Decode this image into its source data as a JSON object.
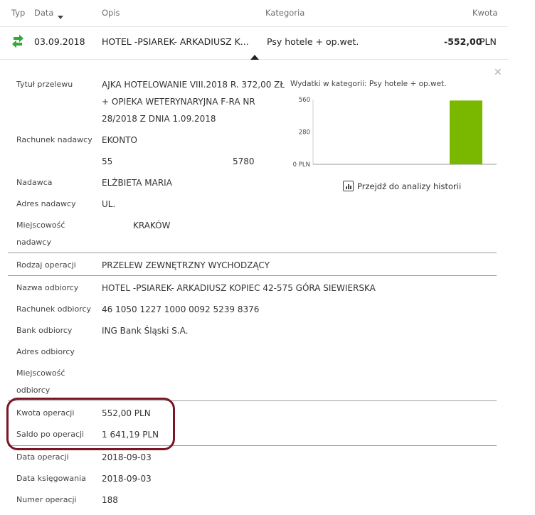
{
  "header": {
    "typ": "Typ",
    "data": "Data",
    "opis": "Opis",
    "kategoria": "Kategoria",
    "kwota": "Kwota"
  },
  "transaction": {
    "date": "03.09.2018",
    "description": "HOTEL -PSIAREK- ARKADIUSZ K...",
    "category": "Psy hotele + op.wet.",
    "amount": "-552,00",
    "currency": "PLN",
    "type_icon_color": "#35a83c"
  },
  "details": {
    "tytul": {
      "label": "Tytuł przelewu",
      "lines": [
        "AJKA HOTELOWANIE VIII.2018 R. 372,00 ZŁ",
        "+ OPIEKA WETERYNARYJNA F-RA NR",
        "28/2018 Z DNIA 1.09.2018"
      ]
    },
    "rachunek_nadawcy": {
      "label": "Rachunek nadawcy",
      "line1": "EKONTO",
      "part1": "55",
      "part2": "5780"
    },
    "nadawca": {
      "label": "Nadawca",
      "value": "ELŻBIETA MARIA"
    },
    "adres_nadawcy": {
      "label": "Adres nadawcy",
      "value": "UL."
    },
    "miejscowosc_nadawcy": {
      "label1": "Miejscowość",
      "label2": "nadawcy",
      "value": "KRAKÓW"
    },
    "rodzaj": {
      "label": "Rodzaj operacji",
      "value": "PRZELEW ZEWNĘTRZNY WYCHODZĄCY"
    },
    "nazwa_odbiorcy": {
      "label": "Nazwa odbiorcy",
      "value": "HOTEL -PSIAREK- ARKADIUSZ KOPIEC 42-575 GÓRA SIEWIERSKA"
    },
    "rachunek_odbiorcy": {
      "label": "Rachunek odbiorcy",
      "value": "46 1050 1227 1000 0092 5239 8376"
    },
    "bank_odbiorcy": {
      "label": "Bank odbiorcy",
      "value": "ING Bank Śląski S.A."
    },
    "adres_odbiorcy": {
      "label": "Adres odbiorcy",
      "value": ""
    },
    "miejscowosc_odbiorcy": {
      "label1": "Miejscowość",
      "label2": "odbiorcy",
      "value": ""
    },
    "kwota": {
      "label": "Kwota operacji",
      "value": "552,00 PLN"
    },
    "saldo": {
      "label": "Saldo po operacji",
      "value": "1 641,19 PLN"
    },
    "data_operacji": {
      "label": "Data operacji",
      "value": "2018-09-03"
    },
    "data_ksiegowania": {
      "label": "Data księgowania",
      "value": "2018-09-03"
    },
    "numer": {
      "label": "Numer operacji",
      "value": "188"
    }
  },
  "highlight_color": "#7a1526",
  "chart_data": {
    "type": "bar",
    "title": "Wydatki w kategorii:  Psy hotele + op.wet.",
    "categories": [
      "",
      "",
      ""
    ],
    "values": [
      0,
      0,
      552
    ],
    "yticks": [
      "0 PLN",
      "280",
      "560"
    ],
    "ylim": [
      0,
      560
    ],
    "bar_color": "#7ab800"
  },
  "analysis_link": "Przejdź do analizy historii"
}
